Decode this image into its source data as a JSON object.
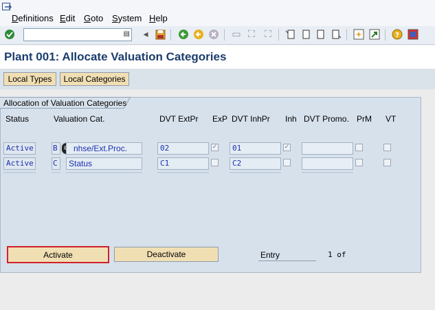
{
  "menu": {
    "items": [
      {
        "label": "Definitions",
        "accel": "D",
        "rest": "efinitions"
      },
      {
        "label": "Edit",
        "accel": "E",
        "rest": "dit"
      },
      {
        "label": "Goto",
        "accel": "G",
        "rest": "oto"
      },
      {
        "label": "System",
        "accel": "S",
        "rest": "ystem"
      },
      {
        "label": "Help",
        "accel": "H",
        "rest": "elp"
      }
    ]
  },
  "toolbar": {
    "command_value": "",
    "icons": [
      "enter-icon",
      "save-icon",
      "back-icon",
      "exit-icon",
      "cancel-icon",
      "print-icon",
      "find-icon",
      "find-next-icon",
      "first-page-icon",
      "previous-page-icon",
      "next-page-icon",
      "last-page-icon",
      "create-session-icon",
      "shortcut-icon",
      "help-icon",
      "customize-layout-icon"
    ]
  },
  "title": {
    "prefix": "Plant",
    "text": "001: Allocate Valuation Categories"
  },
  "app_toolbar": {
    "local_types": "Local Types",
    "local_categories": "Local Categories"
  },
  "panel": {
    "title": "Allocation of Valuation Categories",
    "columns": {
      "status": "Status",
      "valuation_cat": "Valuation Cat.",
      "dvt_extpr": "DVT ExtPr",
      "exp": "ExP",
      "dvt_inhpr": "DVT InhPr",
      "inh": "Inh",
      "dvt_promo": "DVT Promo.",
      "prm": "PrM",
      "vt": "VT"
    },
    "rows": [
      {
        "status": "Active",
        "code": "B",
        "description": "nhse/Ext.Proc.",
        "dvt_extpr": "02",
        "exp": true,
        "dvt_inhpr": "01",
        "inh": true,
        "dvt_promo": "",
        "prm": false,
        "vt": false
      },
      {
        "status": "Active",
        "code": "C",
        "description": "Status",
        "dvt_extpr": "C1",
        "exp": false,
        "dvt_inhpr": "C2",
        "inh": false,
        "dvt_promo": "",
        "prm": false,
        "vt": false
      }
    ],
    "activate": "Activate",
    "deactivate": "Deactivate",
    "entry_label": "Entry",
    "entry_value": "1 of"
  },
  "colors": {
    "title": "#1c3d6c",
    "field_text": "#1a2fb0",
    "button_fill": "#f1dfb4",
    "highlight": "#d0202a",
    "panel": "#d7e1ec"
  }
}
